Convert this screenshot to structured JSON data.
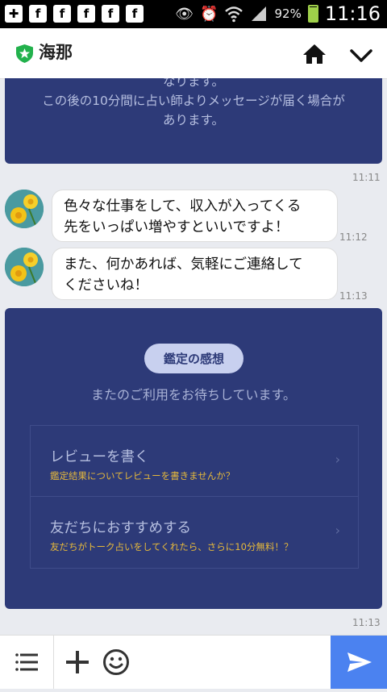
{
  "status_bar": {
    "left_icons": [
      "plus-square-icon",
      "facebook-icon",
      "facebook-icon",
      "facebook-icon",
      "facebook-icon",
      "facebook-icon"
    ],
    "right_icons": [
      "eye-icon",
      "alarm-icon",
      "wifi-icon",
      "signal-icon"
    ],
    "battery_percent": "92%",
    "battery_level": 0.92,
    "time": "11:16"
  },
  "header": {
    "title": "海那",
    "badge_color": "#22b14c"
  },
  "messages": {
    "system_1": {
      "lines": [
        "なります。",
        "この後の10分間に占い師よりメッセージが届く場合が",
        "あります。"
      ],
      "time": "11:11"
    },
    "bubble_1": {
      "lines": [
        "色々な仕事をして、収入が入ってくる",
        "先をいっぱい増やすといいですよ！"
      ],
      "time": "11:12"
    },
    "bubble_2": {
      "lines": [
        "また、何かあれば、気軽にご連絡して",
        "くださいね！"
      ],
      "time": "11:13"
    },
    "review_card": {
      "pill": "鑑定の感想",
      "subtitle": "またのご利用をお待ちしています。",
      "items": [
        {
          "title": "レビューを書く",
          "desc": "鑑定結果についてレビューを書きませんか？"
        },
        {
          "title": "友だちにおすすめする",
          "desc": "友だちがトーク占いをしてくれたら、さらに10分無料！？"
        }
      ],
      "time": "11:13"
    }
  },
  "colors": {
    "system_card": "#2d3a78",
    "accent_send": "#4b82f0",
    "desc_text": "#e6b93b"
  }
}
